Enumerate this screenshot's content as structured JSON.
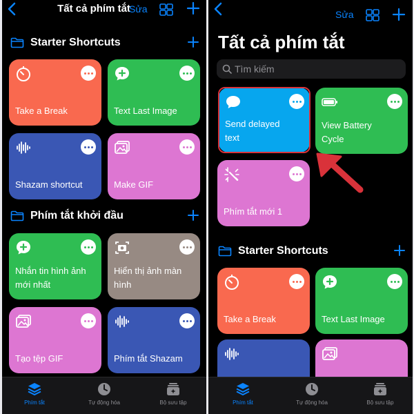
{
  "colors": {
    "accent": "#0a84ff",
    "orange": "#f9694f",
    "green": "#2fbd53",
    "blue": "#3a57b4",
    "pink": "#dd76d2",
    "taupe": "#978a83",
    "cyan": "#07a6ee",
    "annotation_red": "#d9323a"
  },
  "left": {
    "nav": {
      "title": "Tất cả phím tắt",
      "edit": "Sửa",
      "back_icon": "chevron-left-icon",
      "grid_icon": "grid-icon",
      "add_icon": "plus-icon"
    },
    "sections": [
      {
        "title": "Starter Shortcuts",
        "tiles": [
          {
            "label": "Take a Break",
            "icon": "timer-icon",
            "color": "#f9694f"
          },
          {
            "label": "Text Last Image",
            "icon": "message-plus-icon",
            "color": "#2fbd53"
          },
          {
            "label": "Shazam shortcut",
            "icon": "waveform-icon",
            "color": "#3a57b4"
          },
          {
            "label": "Make GIF",
            "icon": "photos-icon",
            "color": "#dd76d2"
          }
        ]
      },
      {
        "title": "Phím tắt khởi đầu",
        "tiles": [
          {
            "label": "Nhắn tin hình ảnh mới nhất",
            "icon": "message-plus-icon",
            "color": "#2fbd53"
          },
          {
            "label": "Hiển thị ảnh màn hình",
            "icon": "camera-viewfinder-icon",
            "color": "#978a83"
          },
          {
            "label": "Tạo tệp GIF",
            "icon": "photos-icon",
            "color": "#dd76d2"
          },
          {
            "label": "Phím tắt Shazam",
            "icon": "waveform-icon",
            "color": "#3a57b4"
          }
        ]
      }
    ],
    "tabs": [
      {
        "label": "Phím tắt",
        "icon": "layers-icon",
        "active": true
      },
      {
        "label": "Tự động hóa",
        "icon": "clock-icon",
        "active": false
      },
      {
        "label": "Bộ sưu tập",
        "icon": "gallery-icon",
        "active": false
      }
    ]
  },
  "right": {
    "nav": {
      "edit": "Sửa",
      "back_icon": "chevron-left-icon",
      "grid_icon": "grid-icon",
      "add_icon": "plus-icon"
    },
    "title": "Tất cả phím tắt",
    "search": {
      "placeholder": "Tìm kiếm",
      "value": ""
    },
    "tiles": [
      {
        "label": "Send delayed text",
        "icon": "speech-bubble-icon",
        "color": "#07a6ee",
        "highlighted": true
      },
      {
        "label": "View Battery Cycle",
        "icon": "battery-icon",
        "color": "#2fbd53"
      },
      {
        "label": "Phím tắt mới 1",
        "icon": "sparkle-icon",
        "color": "#dd76d2"
      }
    ],
    "section": {
      "title": "Starter Shortcuts",
      "tiles": [
        {
          "label": "Take a Break",
          "icon": "timer-icon",
          "color": "#f9694f"
        },
        {
          "label": "Text Last Image",
          "icon": "message-plus-icon",
          "color": "#2fbd53"
        },
        {
          "label": "",
          "icon": "waveform-icon",
          "color": "#3a57b4"
        },
        {
          "label": "",
          "icon": "photos-icon",
          "color": "#dd76d2"
        }
      ]
    },
    "tabs": [
      {
        "label": "Phím tắt",
        "icon": "layers-icon",
        "active": true
      },
      {
        "label": "Tự động hóa",
        "icon": "clock-icon",
        "active": false
      },
      {
        "label": "Bộ sưu tập",
        "icon": "gallery-icon",
        "active": false
      }
    ],
    "annotation": {
      "arrow_icon": "red-arrow-icon"
    }
  }
}
